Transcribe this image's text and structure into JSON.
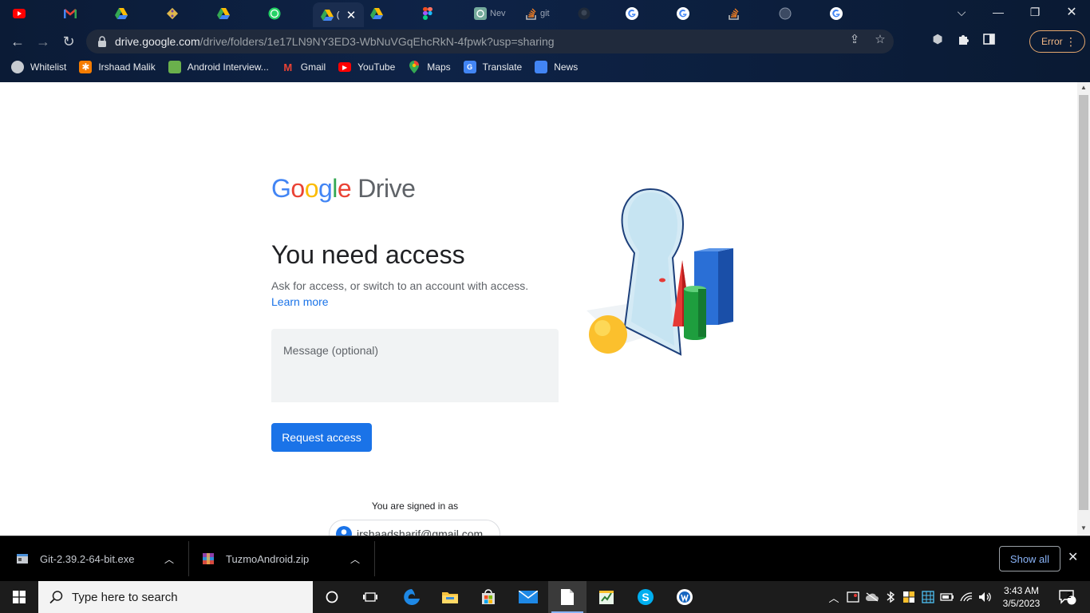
{
  "browser": {
    "address": {
      "domain": "drive.google.com",
      "path": "/drive/folders/1e17LN9NY3ED3-WbNuVGqEhcRkN-4fpwk?usp=sharing"
    },
    "tabs": [
      {
        "icon": "youtube-icon",
        "title": ""
      },
      {
        "icon": "gmail-icon",
        "title": ""
      },
      {
        "icon": "google-drive-icon",
        "title": ""
      },
      {
        "icon": "git-icon",
        "title": ""
      },
      {
        "icon": "google-drive-icon",
        "title": ""
      },
      {
        "icon": "whatsapp-icon",
        "title": ""
      },
      {
        "icon": "google-drive-icon",
        "title": "("
      },
      {
        "icon": "google-drive-icon",
        "title": ""
      },
      {
        "icon": "figma-icon",
        "title": ""
      },
      {
        "icon": "chatgpt-icon",
        "title": "Nev"
      },
      {
        "icon": "stackoverflow-icon",
        "title": "git"
      },
      {
        "icon": "github-icon",
        "title": ""
      },
      {
        "icon": "google-icon",
        "title": ""
      },
      {
        "icon": "google-icon",
        "title": ""
      },
      {
        "icon": "stackoverflow-icon",
        "title": ""
      },
      {
        "icon": "globe-icon",
        "title": ""
      },
      {
        "icon": "google-icon",
        "title": ""
      }
    ],
    "error_label": "Error",
    "bookmarks": [
      {
        "icon": "globe-icon",
        "label": "Whitelist"
      },
      {
        "icon": "irshaad-icon",
        "label": "Irshaad Malik"
      },
      {
        "icon": "android-icon",
        "label": "Android Interview..."
      },
      {
        "icon": "gmail-icon",
        "label": "Gmail"
      },
      {
        "icon": "youtube-icon",
        "label": "YouTube"
      },
      {
        "icon": "maps-icon",
        "label": "Maps"
      },
      {
        "icon": "translate-icon",
        "label": "Translate"
      },
      {
        "icon": "news-icon",
        "label": "News"
      }
    ]
  },
  "page": {
    "logo_word": "Google",
    "logo_product": "Drive",
    "heading": "You need access",
    "subtitle": "Ask for access, or switch to an account with access.",
    "learn_more": "Learn more",
    "message_placeholder": "Message (optional)",
    "request_button": "Request access",
    "signed_in_label": "You are signed in as",
    "email": "irshaadsharif@gmail.com"
  },
  "downloads": {
    "items": [
      {
        "name": "Git-2.39.2-64-bit.exe"
      },
      {
        "name": "TuzmoAndroid.zip"
      }
    ],
    "show_all": "Show all"
  },
  "taskbar": {
    "search_placeholder": "Type here to search",
    "time": "3:43 AM",
    "date": "3/5/2023",
    "notification_count": "2"
  }
}
